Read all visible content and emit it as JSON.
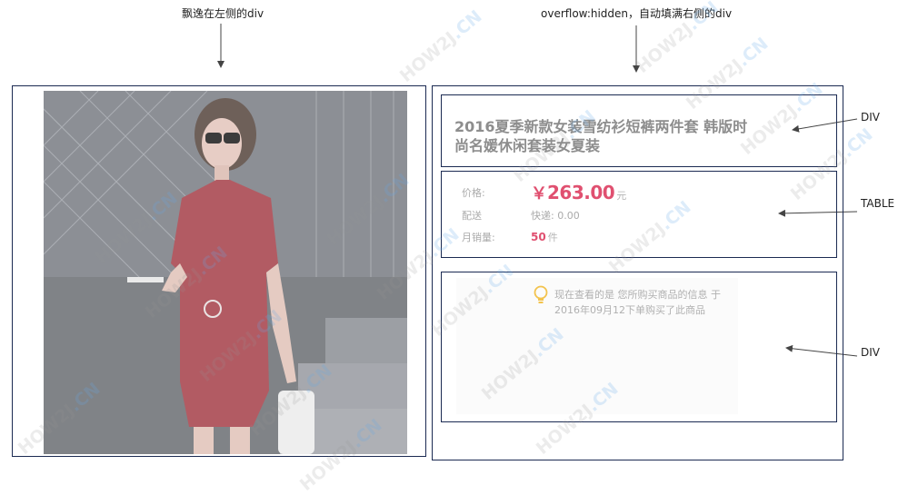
{
  "annotations": {
    "left_float": "飘逸在左侧的div",
    "right_fill": "overflow:hidden，自动填满右侧的div",
    "div_top": "DIV",
    "table": "TABLE",
    "div_bottom": "DIV"
  },
  "product": {
    "title": "2016夏季新款女装雪纺衫短裤两件套 韩版时尚名媛休闲套装女夏装",
    "rows": {
      "price_label": "价格:",
      "price_currency": "￥",
      "price_value": "263.00",
      "price_unit": "元",
      "shipping_label": "配送",
      "shipping_value": "快递: 0.00",
      "sales_label": "月销量:",
      "sales_value": "50",
      "sales_unit": "件"
    },
    "notice": "现在查看的是 您所购买商品的信息 于2016年09月12下单购买了此商品",
    "notice_icon": "lightbulb-icon"
  },
  "watermark": {
    "text": "HOW2J",
    "suffix": ".CN"
  },
  "colors": {
    "border": "#1b2a52",
    "price": "#e05070",
    "dress": "#a8454e"
  }
}
